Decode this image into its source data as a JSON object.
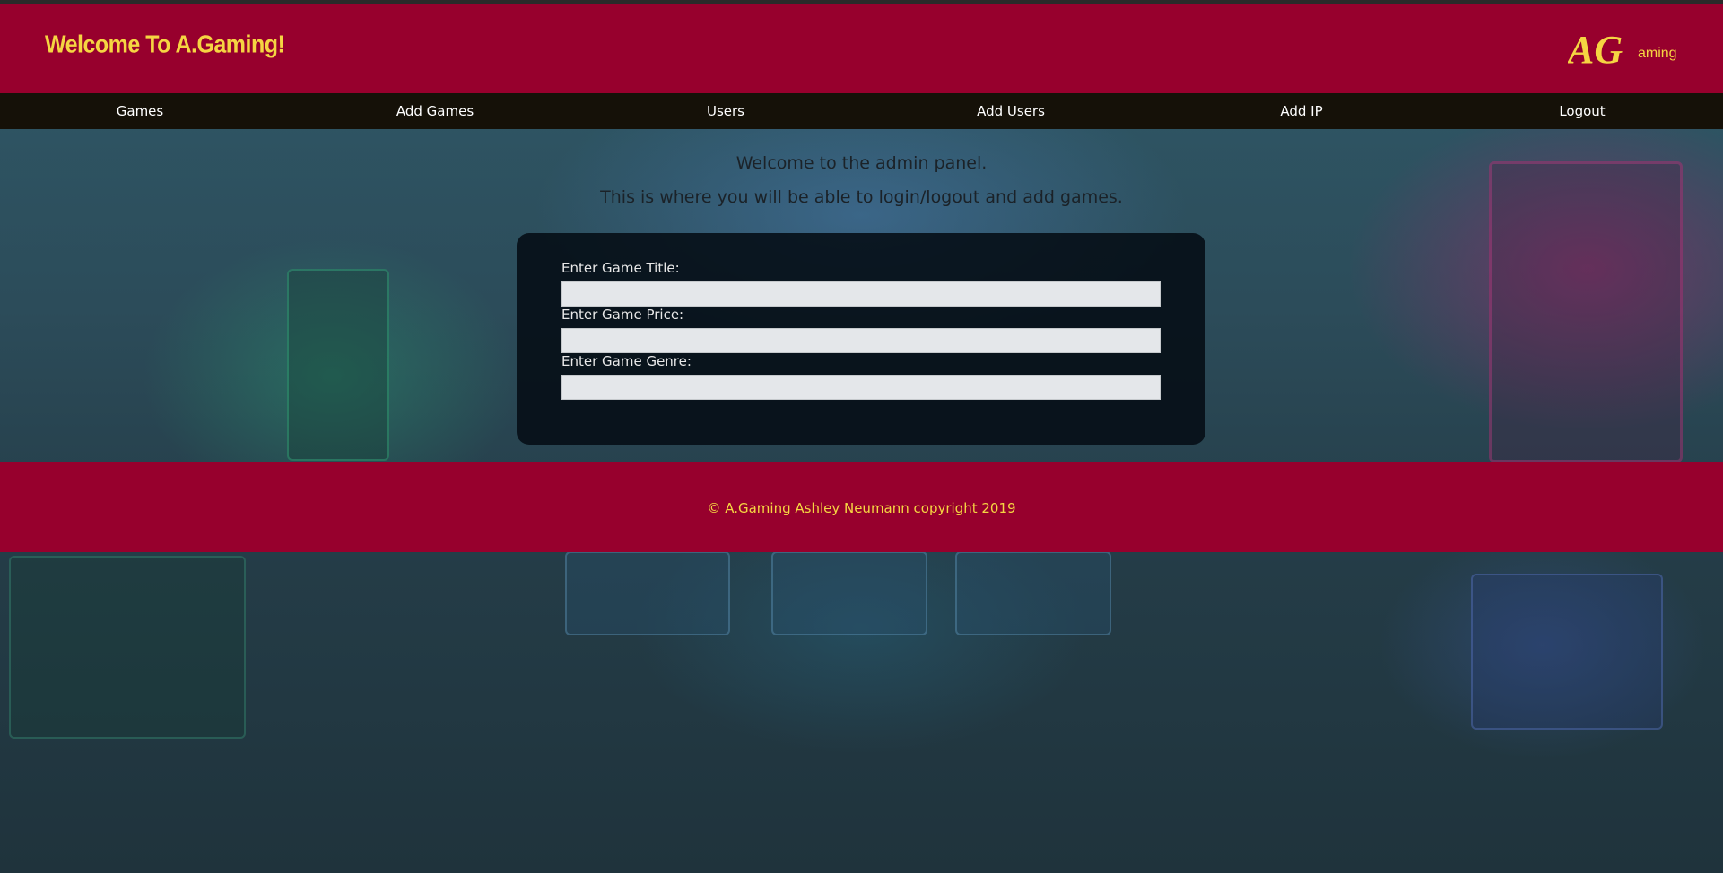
{
  "header": {
    "title": "Welcome To A.Gaming!",
    "logo_text": "AGaming",
    "logo_big": "AG",
    "logo_small": "aming"
  },
  "nav": {
    "items": [
      {
        "label": "Games"
      },
      {
        "label": "Add Games"
      },
      {
        "label": "Users"
      },
      {
        "label": "Add Users"
      },
      {
        "label": "Add IP"
      },
      {
        "label": "Logout"
      }
    ]
  },
  "main": {
    "welcome_line1": "Welcome to the admin panel.",
    "welcome_line2": "This is where you will be able to login/logout and add games."
  },
  "form": {
    "fields": [
      {
        "label": "Enter Game Title:",
        "value": ""
      },
      {
        "label": "Enter Game Price:",
        "value": ""
      },
      {
        "label": "Enter Game Genre:",
        "value": ""
      }
    ]
  },
  "footer": {
    "copyright": "© A.Gaming Ashley Neumann copyright 2019"
  },
  "colors": {
    "brand_red": "#97002d",
    "brand_yellow": "#f5d542",
    "nav_dark": "#151108"
  },
  "background": {
    "description_icon": "arcade-machines-photo"
  }
}
